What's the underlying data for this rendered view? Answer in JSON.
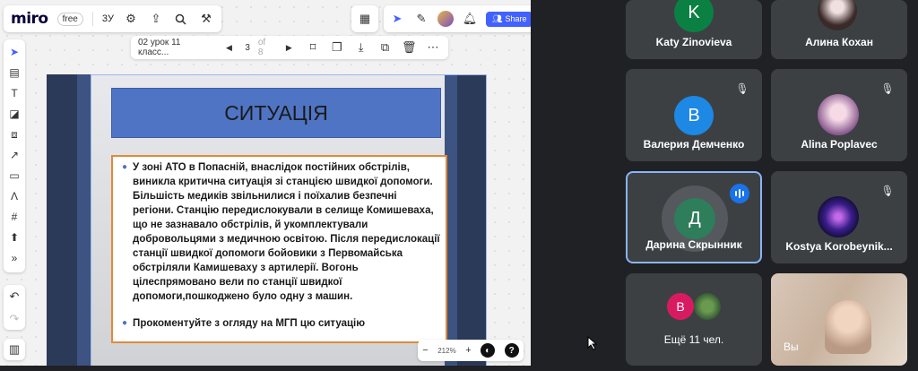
{
  "miro": {
    "logo": "miro",
    "plan": "free",
    "board_label": "3У",
    "share_label": "Share",
    "frame_name": "02 урок 11 класс...",
    "frame_current": "3",
    "frame_of": "of 8",
    "zoom": "212%",
    "help": "?"
  },
  "slide": {
    "title": "СИТУАЦІЯ",
    "paragraph": "У зоні АТО в Попасній, внаслідок постійних обстрілів, виникла критична ситуація зі станцією швидкої допомоги. Більшість медиків звільнилися і поїхалив безпечні регіони. Станцію передислокували в селище Комишеваха, що не зазнавало обстрілів, й укомплектували добровольцями з медичною освітою. Після передислокації станції швидкої допомоги бойовики з Первомайська обстріляли Камишеваху з артилерії. Вогонь цілеспрямовано вели по станції швидкої допомоги,пошкоджено було одну з машин.",
    "prompt": "Прокоментуйте з огляду на МГП цю ситуацію"
  },
  "meet": {
    "participants": [
      {
        "name": "Katy Zinovieva",
        "initial": "K",
        "color": "#0b8043"
      },
      {
        "name": "Алина Кохан",
        "initial": "",
        "color": "#5f6368"
      },
      {
        "name": "Валерия Демченко",
        "initial": "B",
        "color": "#1e88e5"
      },
      {
        "name": "Alina Poplavec",
        "initial": "",
        "color": "#c59bd6"
      },
      {
        "name": "Дарина Скрынник",
        "initial": "Д",
        "color": "#2e7d5b"
      },
      {
        "name": "Kostya Korobeynik...",
        "initial": "",
        "color": "#3a1e8c"
      }
    ],
    "more_label": "Ещё 11 чел.",
    "more_initial": "B",
    "you_label": "Вы"
  }
}
